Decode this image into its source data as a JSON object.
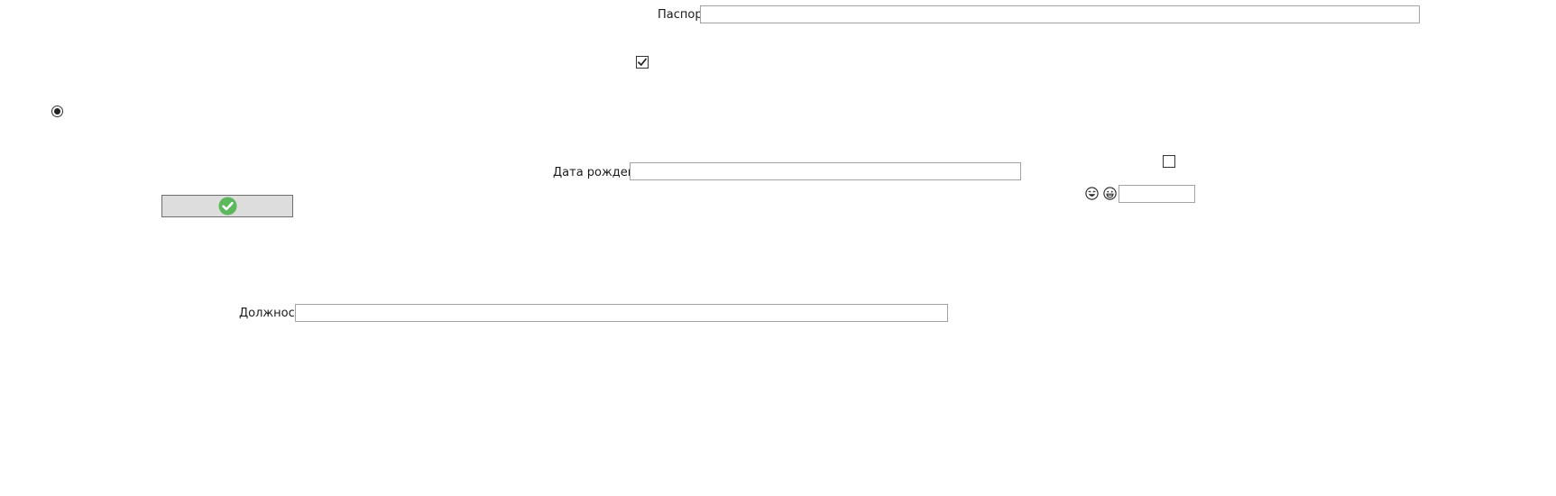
{
  "form": {
    "passport_label": "Паспорт",
    "passport_value": "",
    "birthdate_label": "Дата рождения",
    "birthdate_value": "",
    "position_label": "Должность",
    "position_value": "",
    "small_field_value": "",
    "checkbox_top_checked": true,
    "checkbox_right_checked": false,
    "radio_selected": true
  },
  "icons": {
    "confirm_button_icon": "check-circle-icon",
    "emoji_1": "laughing-face-icon",
    "emoji_2": "grinning-face-icon"
  },
  "colors": {
    "confirm_green": "#5cb85c",
    "button_bg": "#dddddd",
    "field_border": "#a3a3a3"
  }
}
